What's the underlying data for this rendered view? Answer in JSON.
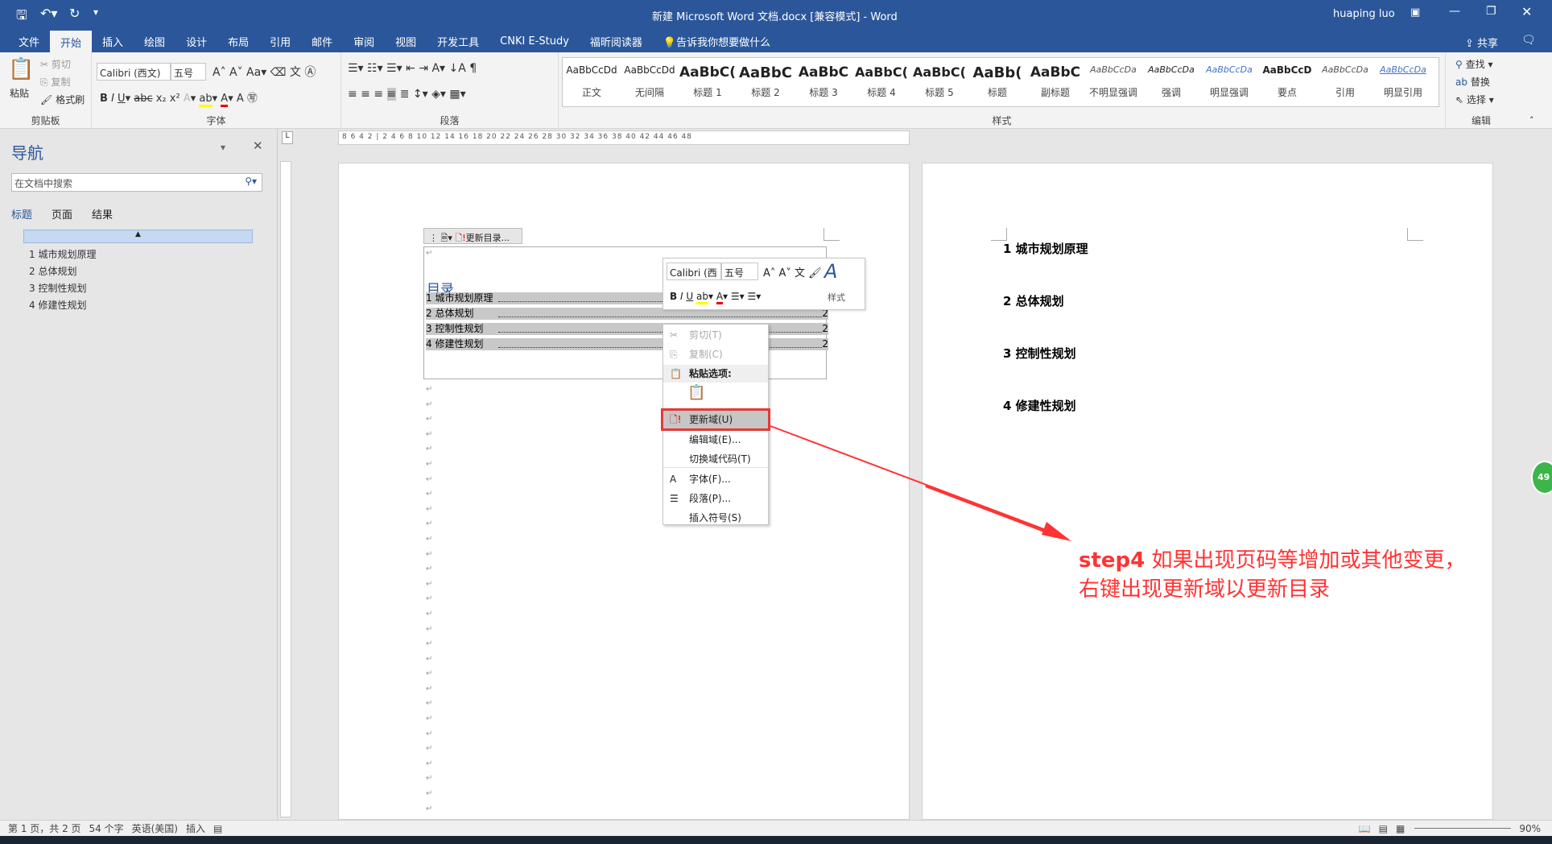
{
  "window": {
    "title": "新建 Microsoft Word 文档.docx [兼容模式] - Word",
    "user": "huaping luo",
    "share": "共享"
  },
  "tabs": [
    "文件",
    "开始",
    "插入",
    "绘图",
    "设计",
    "布局",
    "引用",
    "邮件",
    "审阅",
    "视图",
    "开发工具",
    "CNKI E-Study",
    "福昕阅读器"
  ],
  "tell_me": "告诉我你想要做什么",
  "ribbon": {
    "clipboard": {
      "paste": "粘贴",
      "cut": "剪切",
      "copy": "复制",
      "format_painter": "格式刷",
      "label": "剪贴板"
    },
    "font": {
      "name": "Calibri (西文)",
      "size": "五号",
      "label": "字体"
    },
    "paragraph": {
      "label": "段落"
    },
    "styles": {
      "label": "样式",
      "items": [
        {
          "preview": "AaBbCcDd",
          "name": "正文"
        },
        {
          "preview": "AaBbCcDd",
          "name": "无间隔"
        },
        {
          "preview": "AaBbC(",
          "name": "标题 1"
        },
        {
          "preview": "AaBbC",
          "name": "标题 2"
        },
        {
          "preview": "AaBbC",
          "name": "标题 3"
        },
        {
          "preview": "AaBbC(",
          "name": "标题 4"
        },
        {
          "preview": "AaBbC(",
          "name": "标题 5"
        },
        {
          "preview": "AaBb(",
          "name": "标题"
        },
        {
          "preview": "AaBbC",
          "name": "副标题"
        },
        {
          "preview": "AaBbCcDa",
          "name": "不明显强调"
        },
        {
          "preview": "AaBbCcDa",
          "name": "强调"
        },
        {
          "preview": "AaBbCcDa",
          "name": "明显强调"
        },
        {
          "preview": "AaBbCcD",
          "name": "要点"
        },
        {
          "preview": "AaBbCcDa",
          "name": "引用"
        },
        {
          "preview": "AaBbCcDa",
          "name": "明显引用"
        }
      ]
    },
    "editing": {
      "find": "查找",
      "replace": "替换",
      "select": "选择",
      "label": "编辑"
    }
  },
  "nav": {
    "title": "导航",
    "search_placeholder": "在文档中搜索",
    "tabs": [
      "标题",
      "页面",
      "结果"
    ],
    "headings": [
      "1 城市规划原理",
      "2 总体规划",
      "3 控制性规划",
      "4 修建性规划"
    ]
  },
  "ruler": "8 6 4 2 | 2 4 6 8 10 12 14 16 18 20 22 24 26 28 30 32 34 36 38 40 42 44 46 48",
  "toc": {
    "update_button": "更新目录...",
    "title": "目录",
    "rows": [
      {
        "num": "1",
        "text": "城市规划原理",
        "page": "2"
      },
      {
        "num": "2",
        "text": "总体规划",
        "page": "2"
      },
      {
        "num": "3",
        "text": "控制性规划",
        "page": "2"
      },
      {
        "num": "4",
        "text": "修建性规划",
        "page": "2"
      }
    ]
  },
  "mini_toolbar": {
    "font": "Calibri (西",
    "size": "五号",
    "styles": "样式"
  },
  "context_menu": {
    "items": [
      {
        "label": "剪切(T)",
        "icon": "scissors-icon",
        "disabled": true
      },
      {
        "label": "复制(C)",
        "icon": "copy-icon",
        "disabled": true
      },
      {
        "label": "粘贴选项:",
        "icon": "paste-icon",
        "disabled": false
      },
      {
        "label": "更新域(U)",
        "icon": "update-field-icon",
        "disabled": false,
        "highlighted": true
      },
      {
        "label": "编辑域(E)...",
        "icon": "",
        "disabled": false
      },
      {
        "label": "切换域代码(T)",
        "icon": "",
        "disabled": false
      },
      {
        "label": "字体(F)...",
        "icon": "font-icon",
        "disabled": false
      },
      {
        "label": "段落(P)...",
        "icon": "paragraph-icon",
        "disabled": false
      },
      {
        "label": "插入符号(S)",
        "icon": "",
        "disabled": false
      }
    ]
  },
  "page2": {
    "headings": [
      "1 城市规划原理",
      "2 总体规划",
      "3 控制性规划",
      "4 修建性规划"
    ]
  },
  "annotation": {
    "line1_prefix": "step4",
    "line1": " 如果出现页码等增加或其他变更，",
    "line2": "右键出现更新域以更新目录",
    "color": "#ff3333"
  },
  "status": {
    "page": "第 1 页，共 2 页",
    "words": "54 个字",
    "lang": "英语(美国)",
    "mode": "插入",
    "zoom": "90%"
  },
  "badge": "49",
  "colors": {
    "accent": "#2b579a",
    "highlight_box": "#e53935"
  }
}
